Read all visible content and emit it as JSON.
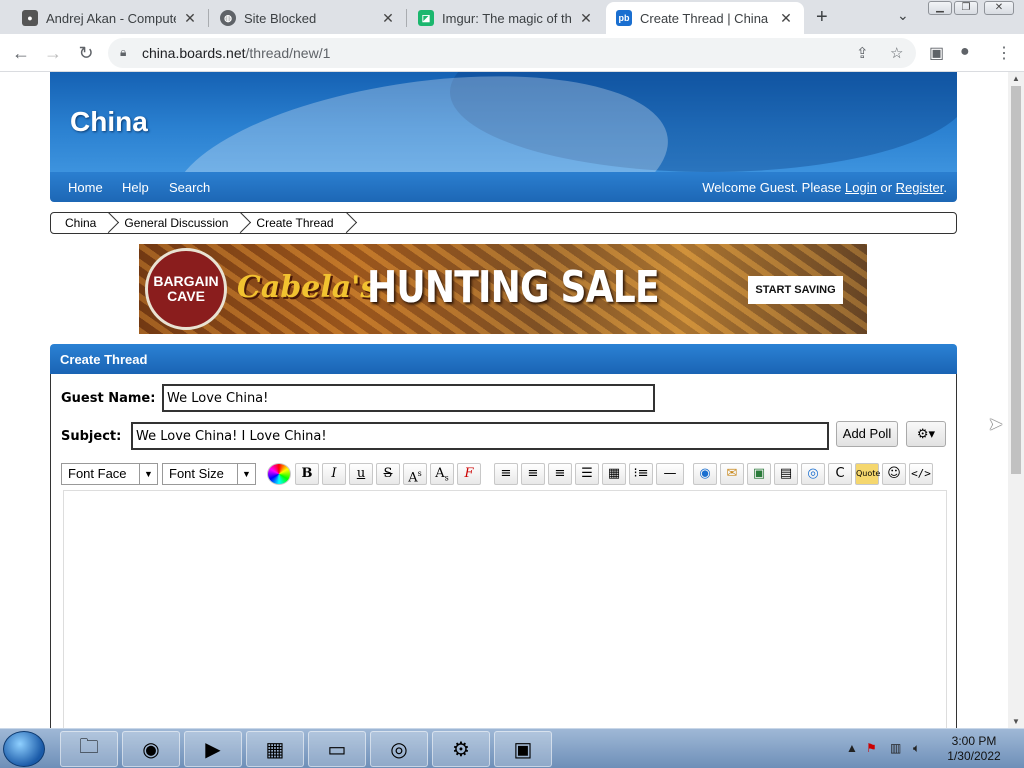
{
  "browser": {
    "tabs": [
      {
        "title": "Andrej Akan - Computer"
      },
      {
        "title": "Site Blocked"
      },
      {
        "title": "Imgur: The magic of the I"
      },
      {
        "title": "Create Thread | China"
      }
    ],
    "new_tab": "+",
    "url_host": "china.boards.net",
    "url_path": "/thread/new/1"
  },
  "site": {
    "title": "China",
    "nav": [
      "Home",
      "Help",
      "Search"
    ],
    "welcome_prefix": "Welcome Guest. Please",
    "login": "Login",
    "or": "or",
    "register": "Register",
    "welcome_suffix": "."
  },
  "breadcrumbs": [
    "China",
    "General Discussion",
    "Create Thread"
  ],
  "ad": {
    "badge_line1": "BARGAIN",
    "badge_line2": "CAVE",
    "brand": "Cabela's",
    "headline": "HUNTING SALE",
    "cta": "START SAVING"
  },
  "form": {
    "heading": "Create Thread",
    "guest_name_label": "Guest Name:",
    "guest_name_value": "We Love China!",
    "subject_label": "Subject:",
    "subject_value": "We Love China! I Love China!",
    "add_poll": "Add Poll",
    "font_face": "Font Face",
    "font_size": "Font Size"
  },
  "taskbar": {
    "time": "3:00 PM",
    "date": "1/30/2022"
  },
  "colors": {
    "site_blue": "#1d67b5",
    "chrome_bg": "#dee1e6"
  }
}
